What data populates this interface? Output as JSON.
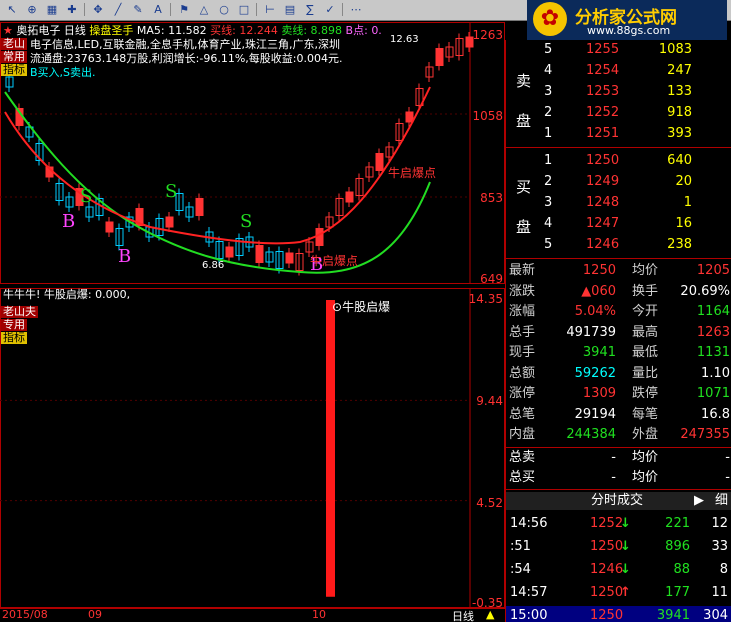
{
  "toolbar": {
    "icons": [
      "arrow-icon",
      "zoom-icon",
      "grid-icon",
      "cross-icon",
      "move-icon",
      "line-icon",
      "draw-icon",
      "text-icon",
      "flag-icon",
      "triangle-icon",
      "circle-icon",
      "rect-icon",
      "ruler-icon",
      "chart-icon",
      "stats-icon",
      "check-icon",
      "more-icon"
    ]
  },
  "brand": {
    "logo_text": "分析家公式网",
    "url": "www.88gs.com",
    "logo_glyph": "✿"
  },
  "main_chart": {
    "title": "奥拓电子",
    "period": "日线",
    "indicator_name": "操盘圣手",
    "ma5_label": "MA5:",
    "ma5_value": "11.582",
    "buy_line_label": "买线:",
    "buy_line_value": "12.244",
    "sell_line_label": "卖线:",
    "sell_line_value": "8.898",
    "b_point_label": "B点:",
    "b_point_value": "0.",
    "info_line1": "电子信息,LED,互联金融,全息手机,体育产业,珠江三角,广东,深圳",
    "info_line2": "流通盘:23763.148万股,利润增长:-96.11%,每股收益:0.004元.",
    "info_line3": "B买入,S卖出.",
    "tag_top": "老山",
    "tag_common": "常用",
    "tag_indicator": "指标",
    "price_labels": [
      "1263",
      "1058",
      "853",
      "649"
    ],
    "high_label": "12.63",
    "low_label": "6.86",
    "annot_start1": "牛启爆点",
    "annot_start2": "牛启爆点",
    "signals": [
      "S",
      "S",
      "S",
      "B",
      "B",
      "B"
    ]
  },
  "indicator_chart": {
    "name": "牛牛牛!",
    "series_label": "牛股启爆:",
    "series_value": "0.000,",
    "legend": "牛股启爆",
    "tag_top": "老山夫",
    "tag_special": "专用",
    "tag_indicator": "指标",
    "axis_labels": [
      "14.35",
      "9.44",
      "4.52",
      "-0.35"
    ]
  },
  "chart_data": {
    "type": "bar",
    "title": "牛股启爆",
    "series": [
      {
        "name": "牛股启爆",
        "values": [
          14.35
        ]
      }
    ],
    "ylim": [
      -0.35,
      14.35
    ]
  },
  "bottom_bar": {
    "date_left": "2015/08",
    "date_mid": "09",
    "date_right": "10",
    "period_tab": "日线"
  },
  "orderbook": {
    "sell_label": [
      "卖",
      "盘"
    ],
    "buy_label": [
      "买",
      "盘"
    ],
    "sells": [
      {
        "level": "5",
        "price": "1255",
        "vol": "1083"
      },
      {
        "level": "4",
        "price": "1254",
        "vol": "247"
      },
      {
        "level": "3",
        "price": "1253",
        "vol": "133"
      },
      {
        "level": "2",
        "price": "1252",
        "vol": "918"
      },
      {
        "level": "1",
        "price": "1251",
        "vol": "393"
      }
    ],
    "buys": [
      {
        "level": "1",
        "price": "1250",
        "vol": "640"
      },
      {
        "level": "2",
        "price": "1249",
        "vol": "20"
      },
      {
        "level": "3",
        "price": "1248",
        "vol": "1"
      },
      {
        "level": "4",
        "price": "1247",
        "vol": "16"
      },
      {
        "level": "5",
        "price": "1246",
        "vol": "238"
      }
    ]
  },
  "quote": [
    {
      "l1": "最新",
      "v1": "1250",
      "c1": "red",
      "l2": "均价",
      "v2": "1205",
      "c2": "red"
    },
    {
      "l1": "涨跌",
      "v1": "▲060",
      "c1": "red",
      "l2": "换手",
      "v2": "20.69%",
      "c2": "white"
    },
    {
      "l1": "涨幅",
      "v1": "5.04%",
      "c1": "red",
      "l2": "今开",
      "v2": "1164",
      "c2": "green"
    },
    {
      "l1": "总手",
      "v1": "491739",
      "c1": "white",
      "l2": "最高",
      "v2": "1263",
      "c2": "red"
    },
    {
      "l1": "现手",
      "v1": "3941",
      "c1": "green",
      "l2": "最低",
      "v2": "1131",
      "c2": "green"
    },
    {
      "l1": "总额",
      "v1": "59262",
      "c1": "cyan",
      "l2": "量比",
      "v2": "1.10",
      "c2": "white"
    },
    {
      "l1": "涨停",
      "v1": "1309",
      "c1": "red",
      "l2": "跌停",
      "v2": "1071",
      "c2": "green"
    },
    {
      "l1": "总笔",
      "v1": "29194",
      "c1": "white",
      "l2": "每笔",
      "v2": "16.8",
      "c2": "white"
    },
    {
      "l1": "内盘",
      "v1": "244384",
      "c1": "green",
      "l2": "外盘",
      "v2": "247355",
      "c2": "red"
    }
  ],
  "totals": [
    {
      "l1": "总卖",
      "v1": "-",
      "l2": "均价",
      "v2": "-"
    },
    {
      "l1": "总买",
      "v1": "-",
      "l2": "均价",
      "v2": "-"
    }
  ],
  "ticks_header": {
    "title": "分时成交",
    "play_glyph": "▶",
    "detail_label": "细"
  },
  "ticks": [
    {
      "time": "14:56",
      "price": "1252",
      "dir": "down",
      "vol": "221",
      "cnt": "12",
      "pc": "red"
    },
    {
      "time": ":51",
      "price": "1250",
      "dir": "down",
      "vol": "896",
      "cnt": "33",
      "pc": "red"
    },
    {
      "time": ":54",
      "price": "1246",
      "dir": "down",
      "vol": "88",
      "cnt": "8",
      "pc": "red"
    },
    {
      "time": "14:57",
      "price": "1250",
      "dir": "up",
      "vol": "177",
      "cnt": "11",
      "pc": "red"
    },
    {
      "time": "15:00",
      "price": "1250",
      "dir": "",
      "vol": "3941",
      "cnt": "304",
      "pc": "red"
    }
  ]
}
